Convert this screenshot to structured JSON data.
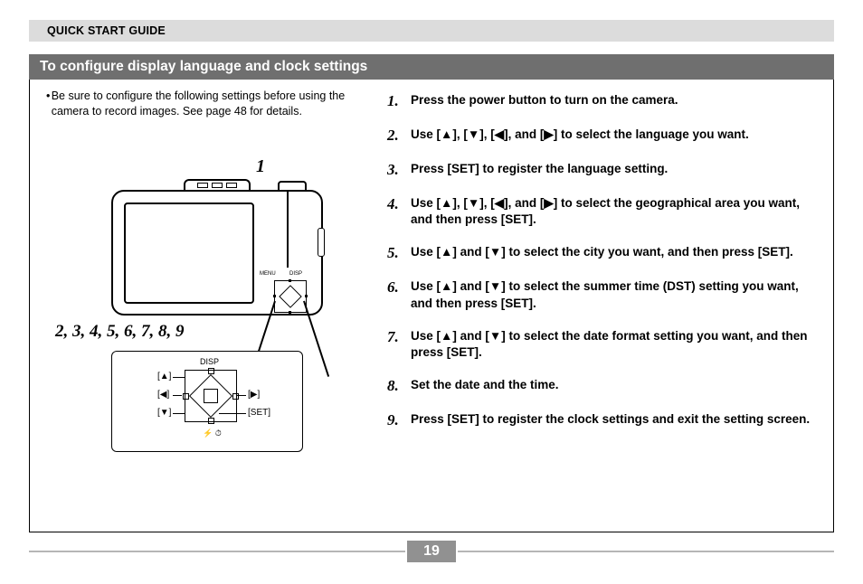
{
  "header": "QUICK START GUIDE",
  "section_title": "To configure display language and clock settings",
  "note_bullet": "•",
  "note_text": "Be sure to configure the following settings before using the camera to record images. See page 48 for details.",
  "callout_top": "1",
  "callout_steps": "2, 3, 4, 5, 6, 7, 8, 9",
  "dpad": {
    "disp": "DISP",
    "menu": "MENU",
    "up": "[▲]",
    "down": "[▼]",
    "left": "[◀]",
    "right": "[▶]",
    "set": "[SET]"
  },
  "steps": [
    {
      "n": "1.",
      "t": "Press the power button to turn on the camera."
    },
    {
      "n": "2.",
      "t": "Use [▲], [▼], [◀], and [▶] to select the language you want."
    },
    {
      "n": "3.",
      "t": "Press [SET] to register the language setting."
    },
    {
      "n": "4.",
      "t": "Use [▲], [▼], [◀], and [▶] to select the geographical area you want, and then press [SET]."
    },
    {
      "n": "5.",
      "t": "Use [▲] and [▼] to select the city you want, and then press [SET]."
    },
    {
      "n": "6.",
      "t": "Use [▲] and [▼] to select the summer time (DST) setting you want, and then press [SET]."
    },
    {
      "n": "7.",
      "t": "Use [▲] and [▼] to select the date format setting you want, and then press [SET]."
    },
    {
      "n": "8.",
      "t": "Set the date and the time."
    },
    {
      "n": "9.",
      "t": "Press [SET] to register the clock settings and exit the setting screen."
    }
  ],
  "page_number": "19"
}
